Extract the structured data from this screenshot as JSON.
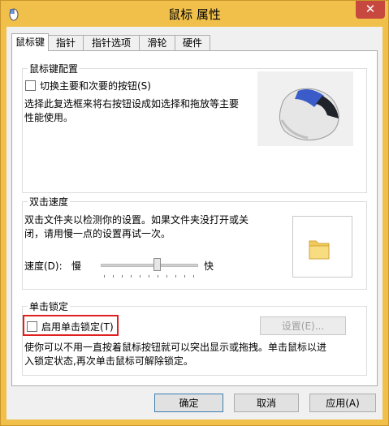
{
  "window": {
    "title": "鼠标 属性",
    "close_glyph": "✕"
  },
  "tabs": [
    {
      "label": "鼠标键",
      "active": true
    },
    {
      "label": "指针"
    },
    {
      "label": "指针选项"
    },
    {
      "label": "滑轮"
    },
    {
      "label": "硬件"
    }
  ],
  "button_config": {
    "group_label": "鼠标键配置",
    "checkbox_label": "切换主要和次要的按钮(S)",
    "checked": false,
    "description_line1": "选择此复选框来将右按钮设成如选择和拖放等主要",
    "description_line2": "性能使用。"
  },
  "double_click": {
    "group_label": "双击速度",
    "description_line1": "双击文件夹以检测你的设置。如果文件夹没打开或关",
    "description_line2": "闭，请用慢一点的设置再试一次。",
    "speed_label": "速度(D):",
    "slow_label": "慢",
    "fast_label": "快",
    "speed_level_percent": 60
  },
  "click_lock": {
    "group_label": "单击锁定",
    "checkbox_label": "启用单击锁定(T)",
    "checked": false,
    "settings_button": "设置(E)...",
    "description_line1": "使你可以不用一直按着鼠标按钮就可以突出显示或拖拽。单击鼠标以进",
    "description_line2": "入锁定状态,再次单击鼠标可解除锁定。"
  },
  "footer": {
    "ok": "确定",
    "cancel": "取消",
    "apply": "应用(A)"
  },
  "colors": {
    "frame": "#f0c04a",
    "close": "#c7483e",
    "highlight": "#e02020"
  }
}
